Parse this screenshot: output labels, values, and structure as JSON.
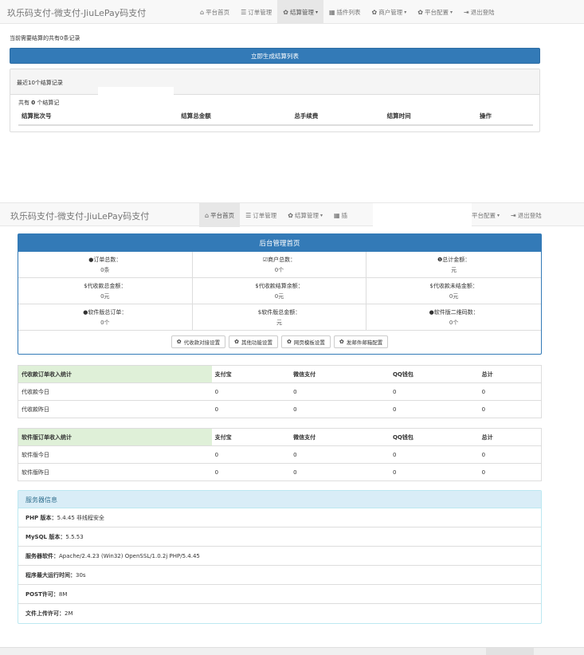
{
  "app": {
    "brand": "玖乐码支付-微支付-JiuLePay码支付"
  },
  "nav_top": [
    {
      "icon": "home-icon",
      "glyph": "⌂",
      "label": "平台首页",
      "caret": ""
    },
    {
      "icon": "list-icon",
      "glyph": "☰",
      "label": "订单管理",
      "caret": ""
    },
    {
      "icon": "cog-icon",
      "glyph": "✿",
      "label": "结算管理",
      "caret": "▾"
    },
    {
      "icon": "grid-icon",
      "glyph": "▦",
      "label": "插件列表",
      "caret": ""
    },
    {
      "icon": "cog-icon",
      "glyph": "✿",
      "label": "商户管理",
      "caret": "▾"
    },
    {
      "icon": "cog-icon",
      "glyph": "✿",
      "label": "平台配置",
      "caret": "▾"
    },
    {
      "icon": "logout-icon",
      "glyph": "⇥",
      "label": "退出登陆",
      "caret": ""
    }
  ],
  "nav_bottom": [
    {
      "icon": "home-icon",
      "glyph": "⌂",
      "label": "平台首页",
      "caret": ""
    },
    {
      "icon": "list-icon",
      "glyph": "☰",
      "label": "订单管理",
      "caret": ""
    },
    {
      "icon": "cog-icon",
      "glyph": "✿",
      "label": "结算管理",
      "caret": "▾"
    },
    {
      "icon": "grid-icon",
      "glyph": "▦",
      "label": "插",
      "caret": ""
    },
    {
      "icon": "cog-icon",
      "glyph": "",
      "label": "平台配置",
      "caret": "▾"
    },
    {
      "icon": "logout-icon",
      "glyph": "⇥",
      "label": "退出登陆",
      "caret": ""
    }
  ],
  "settlement": {
    "pending_text": "当前需要结算的共有0条记录",
    "generate_button": "立即生成结算列表",
    "recent_title": "最近10个结算记录",
    "count_prefix": "共有 ",
    "count_value": "0",
    "count_suffix": " 个结算记",
    "columns": [
      "结算批次号",
      "结算总金额",
      "总手续费",
      "结算时间",
      "操作"
    ]
  },
  "dashboard": {
    "title": "后台管理首页",
    "cells": [
      {
        "icon": "drop-icon",
        "glyph": "●",
        "label": "订单总数：",
        "value": "0条"
      },
      {
        "icon": "check-icon",
        "glyph": "☑",
        "label": "商户总数：",
        "value": "0个"
      },
      {
        "icon": "info-icon",
        "glyph": "❶",
        "label": "总计金额：",
        "value": "元"
      },
      {
        "icon": "dollar-icon",
        "glyph": "$",
        "label": "代收款总金额：",
        "value": "0元"
      },
      {
        "icon": "dollar-icon",
        "glyph": "$",
        "label": "代收款结算余额：",
        "value": "0元"
      },
      {
        "icon": "dollar-icon",
        "glyph": "$",
        "label": "代收款未结金额：",
        "value": "0元"
      },
      {
        "icon": "drop-icon",
        "glyph": "●",
        "label": "软件版总订单：",
        "value": "0个"
      },
      {
        "icon": "dollar-icon",
        "glyph": "$",
        "label": "软件版总金额：",
        "value": "元"
      },
      {
        "icon": "drop-icon",
        "glyph": "●",
        "label": "软件版二维码数：",
        "value": "0个"
      }
    ],
    "buttons": [
      "代收款对接设置",
      "其他功能设置",
      "网页模板设置",
      "发邮件邮箱配置"
    ]
  },
  "stats_collect": {
    "headers": [
      "代收款订单收入统计",
      "支付宝",
      "微信支付",
      "QQ钱包",
      "总计"
    ],
    "rows": [
      [
        "代收款今日",
        "0",
        "0",
        "0",
        "0"
      ],
      [
        "代收款昨日",
        "0",
        "0",
        "0",
        "0"
      ]
    ]
  },
  "stats_software": {
    "headers": [
      "软件版订单收入统计",
      "支付宝",
      "微信支付",
      "QQ钱包",
      "总计"
    ],
    "rows": [
      [
        "软件版今日",
        "0",
        "0",
        "0",
        "0"
      ],
      [
        "软件版昨日",
        "0",
        "0",
        "0",
        "0"
      ]
    ]
  },
  "server": {
    "title": "服务器信息",
    "rows": [
      {
        "label": "PHP 版本：",
        "value": "5.4.45 非线程安全"
      },
      {
        "label": "MySQL 版本：",
        "value": "5.5.53"
      },
      {
        "label": "服务器软件：",
        "value": "Apache/2.4.23 (Win32) OpenSSL/1.0.2j PHP/5.4.45"
      },
      {
        "label": "程序最大运行时间：",
        "value": "30s"
      },
      {
        "label": "POST许可：",
        "value": "8M"
      },
      {
        "label": "文件上传许可：",
        "value": "2M"
      }
    ]
  },
  "colors": {
    "primary": "#337ab7",
    "success_bg": "#dff0d8",
    "info_bg": "#d9edf7",
    "info_text": "#31708f"
  }
}
